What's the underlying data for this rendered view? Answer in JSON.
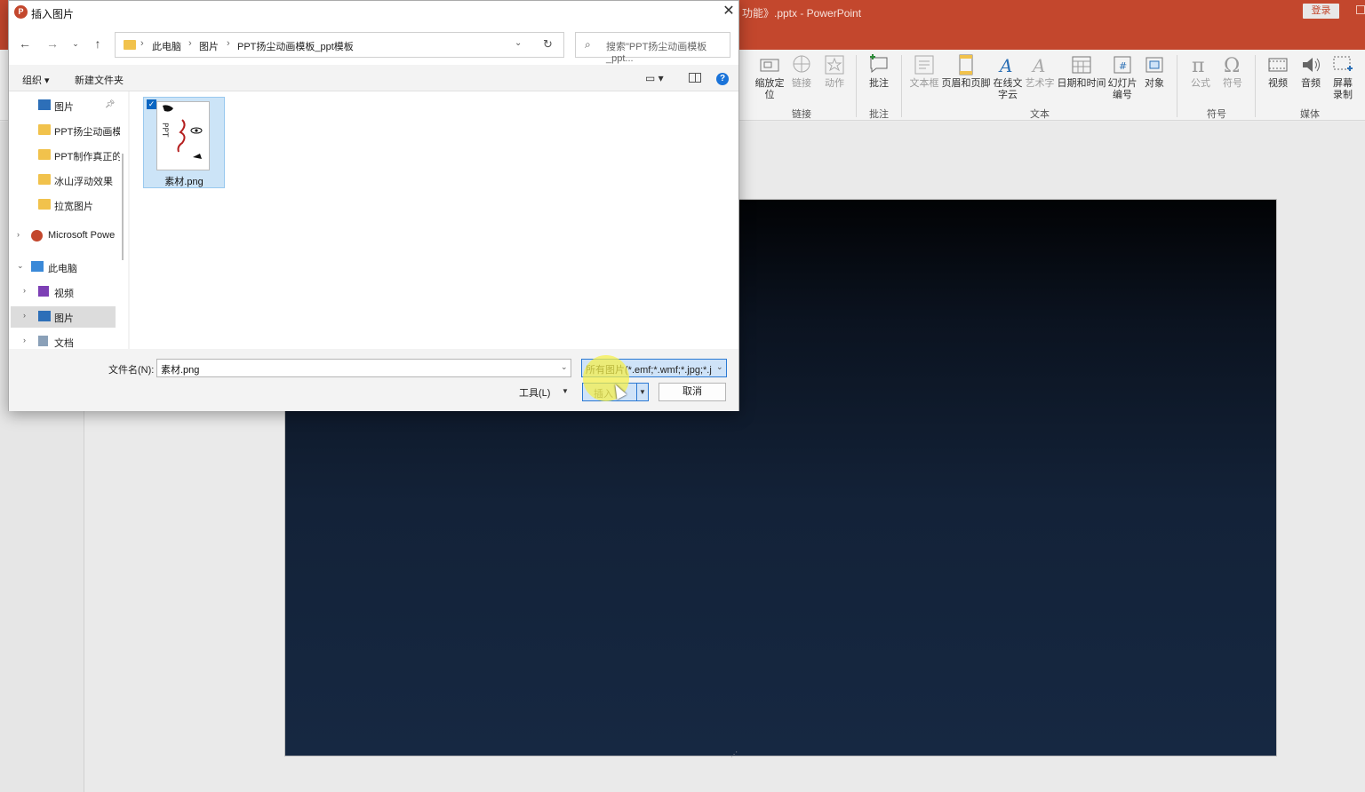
{
  "ppt": {
    "title": "功能》.pptx  -  PowerPoint",
    "login": "登录",
    "ribbon": {
      "buttons": [
        {
          "label": "缩放定位",
          "icon": "zoom-icon"
        },
        {
          "label": "链接",
          "icon": "link-icon"
        },
        {
          "label": "动作",
          "icon": "star-icon"
        },
        {
          "label": "批注",
          "icon": "comment-icon"
        },
        {
          "label": "文本框",
          "icon": "textbox-icon"
        },
        {
          "label": "页眉和页脚",
          "icon": "header-footer-icon"
        },
        {
          "label": "在线文字云",
          "icon": "wordart-icon"
        },
        {
          "label": "艺术字",
          "icon": "wordart-icon"
        },
        {
          "label": "日期和时间",
          "icon": "calendar-icon"
        },
        {
          "label": "幻灯片编号",
          "icon": "slide-number-icon"
        },
        {
          "label": "对象",
          "icon": "object-icon"
        },
        {
          "label": "公式",
          "icon": "equation-icon"
        },
        {
          "label": "符号",
          "icon": "omega-icon"
        },
        {
          "label": "视频",
          "icon": "video-icon"
        },
        {
          "label": "音频",
          "icon": "audio-icon"
        },
        {
          "label": "屏幕录制",
          "icon": "screen-record-icon"
        }
      ],
      "groups": [
        "链接",
        "批注",
        "文本",
        "符号",
        "媒体"
      ]
    }
  },
  "dialog": {
    "title": "插入图片",
    "address": {
      "crumbs": [
        "此电脑",
        "图片",
        "PPT扬尘动画模板_ppt模板"
      ]
    },
    "search_placeholder": "搜索\"PPT扬尘动画模板_ppt...",
    "toolbar": {
      "organize": "组织 ▾",
      "new_folder": "新建文件夹"
    },
    "nav_items": [
      {
        "label": "图片",
        "icon": "pictures-icon"
      },
      {
        "label": "PPT扬尘动画模",
        "icon": "folder-icon"
      },
      {
        "label": "PPT制作真正的",
        "icon": "folder-icon"
      },
      {
        "label": "冰山浮动效果",
        "icon": "folder-icon"
      },
      {
        "label": "拉宽图片",
        "icon": "folder-icon"
      },
      {
        "label": "Microsoft Powe",
        "icon": "powerpoint-icon"
      },
      {
        "label": "此电脑",
        "icon": "computer-icon"
      },
      {
        "label": "视频",
        "icon": "video-icon"
      },
      {
        "label": "图片",
        "icon": "pictures-icon"
      },
      {
        "label": "文档",
        "icon": "documents-icon"
      }
    ],
    "file": {
      "name": "素材.png"
    },
    "filename_label": "文件名(N):",
    "filename_value": "素材.png",
    "filetype_value": "所有图片(*.emf;*.wmf;*.jpg;*.j",
    "tools_label": "工具(L)",
    "insert_label": "插入",
    "cancel_label": "取消"
  }
}
